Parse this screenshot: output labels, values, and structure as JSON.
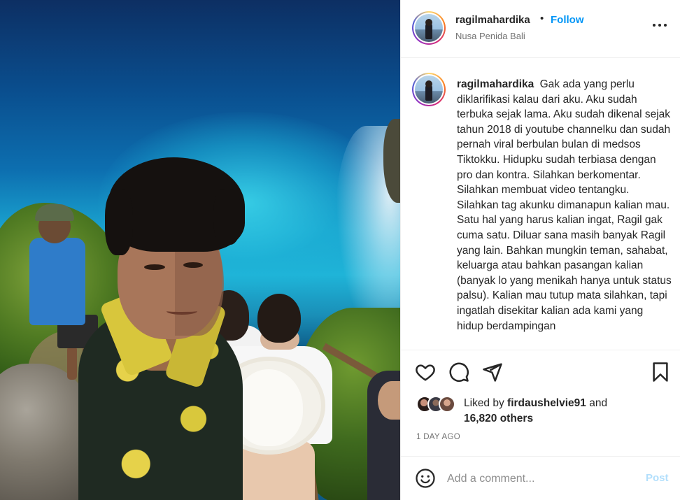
{
  "post": {
    "username": "ragilmahardika",
    "follow_separator": "•",
    "follow_label": "Follow",
    "location": "Nusa Penida Bali",
    "caption_username": "ragilmahardika",
    "caption_text": "Gak ada yang perlu diklarifikasi kalau dari aku. Aku sudah terbuka sejak lama. Aku sudah dikenal sejak tahun 2018 di youtube channelku dan sudah pernah viral berbulan bulan di medsos Tiktokku. Hidupku sudah terbiasa dengan pro dan kontra. Silahkan berkomentar. Silahkan membuat video tentangku. Silahkan tag akunku dimanapun kalian mau. Satu hal yang harus kalian ingat, Ragil gak cuma satu. Diluar sana masih banyak Ragil yang lain. Bahkan mungkin teman, sahabat, keluarga atau bahkan pasangan kalian (banyak lo yang menikah hanya untuk status palsu). Kalian mau tutup mata silahkan, tapi ingatlah disekitar kalian ada kami yang hidup berdampingan",
    "liked_prefix": "Liked by",
    "liked_user": "firdaushelvie91",
    "liked_and": "and",
    "liked_count": "16,820 others",
    "date": "1 DAY AGO"
  },
  "actions": {
    "like_icon": "heart-icon",
    "comment_icon": "comment-icon",
    "share_icon": "share-icon",
    "save_icon": "bookmark-icon",
    "more_icon": "more-options-icon"
  },
  "comment": {
    "placeholder": "Add a comment...",
    "post_label": "Post",
    "emoji_icon": "emoji-icon"
  },
  "colors": {
    "accent": "#0095f6",
    "post_disabled": "#b2dffc",
    "text": "#262626",
    "muted": "#737373",
    "border": "#efefef"
  }
}
